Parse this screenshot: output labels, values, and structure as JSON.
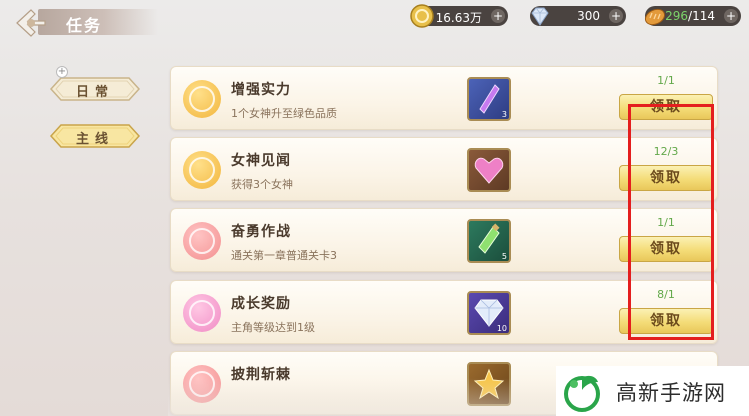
{
  "header": {
    "title": "任务"
  },
  "resources": [
    {
      "icon": "gold-coin-icon",
      "value": "16.63万"
    },
    {
      "icon": "diamond-icon",
      "value": "300"
    },
    {
      "icon": "bread-stamina-icon",
      "current": "296",
      "max": "/114"
    }
  ],
  "tabs": [
    {
      "label": "日常"
    },
    {
      "label": "主线"
    }
  ],
  "tasks": [
    {
      "name": "增强实力",
      "desc": "1个女神升至绿色品质",
      "progress": "1/1",
      "claim": "领取",
      "reward_icon": "purple-crystal-icon",
      "reward_count": "3"
    },
    {
      "name": "女神见闻",
      "desc": "获得3个女神",
      "progress": "12/3",
      "claim": "领取",
      "reward_icon": "pink-heart-gem-icon",
      "reward_count": ""
    },
    {
      "name": "奋勇作战",
      "desc": "通关第一章普通关卡3",
      "progress": "1/1",
      "claim": "领取",
      "reward_icon": "green-potion-icon",
      "reward_count": "5"
    },
    {
      "name": "成长奖励",
      "desc": "主角等级达到1级",
      "progress": "8/1",
      "claim": "领取",
      "reward_icon": "diamond-reward-icon",
      "reward_count": "10"
    },
    {
      "name": "披荆斩棘",
      "desc": "",
      "progress": "",
      "claim": "",
      "reward_icon": "gold-star-icon",
      "reward_count": ""
    }
  ],
  "watermark": {
    "text": "高新手游网"
  },
  "colors": {
    "highlight": "#e41e1e",
    "progress_green": "#62a84a"
  }
}
